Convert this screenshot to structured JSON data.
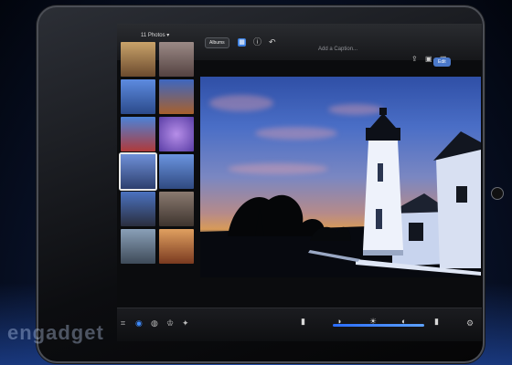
{
  "header": {
    "photos_title": "11 Photos",
    "albums_label": "Albums",
    "caption_placeholder": "Add a Caption...",
    "edit_label": "Edit"
  },
  "thumbnails": [
    {
      "name": "thumb-1",
      "color": "#c8a36a"
    },
    {
      "name": "thumb-2",
      "color": "#9b8a86"
    },
    {
      "name": "thumb-3",
      "color": "#3a62b8"
    },
    {
      "name": "thumb-4",
      "color": "#b26a3c"
    },
    {
      "name": "thumb-5",
      "color": "#3e78c8"
    },
    {
      "name": "thumb-6",
      "color": "#7e5fc7"
    },
    {
      "name": "thumb-7",
      "color": "#5a7ec8",
      "selected": true
    },
    {
      "name": "thumb-8",
      "color": "#5a84d6"
    },
    {
      "name": "thumb-9",
      "color": "#4b72c0"
    },
    {
      "name": "thumb-10",
      "color": "#6b5a52"
    },
    {
      "name": "thumb-11",
      "color": "#7a8ca0"
    },
    {
      "name": "thumb-12",
      "color": "#c77c44"
    }
  ],
  "toolbar": {
    "tools": [
      "crop-icon",
      "brush-icon",
      "color-icon",
      "effects-icon",
      "sparkle-icon"
    ],
    "active_tool": "brush-icon",
    "slider_icons": [
      "phone-icon",
      "contrast-icon",
      "brightness-icon",
      "contrast-icon",
      "phone-icon"
    ],
    "settings_icon": "gear-icon"
  },
  "watermark": "engadget",
  "colors": {
    "accent": "#3f8cff",
    "edit_button": "#4a78c9"
  }
}
